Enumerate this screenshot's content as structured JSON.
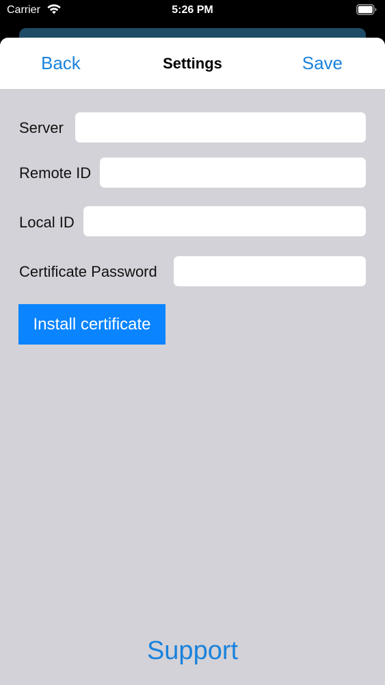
{
  "status_bar": {
    "carrier": "Carrier",
    "time": "5:26 PM",
    "icons": [
      "wifi-icon",
      "battery-icon"
    ]
  },
  "nav": {
    "back_label": "Back",
    "title": "Settings",
    "save_label": "Save"
  },
  "form": {
    "server": {
      "label": "Server",
      "value": ""
    },
    "remote_id": {
      "label": "Remote ID",
      "value": ""
    },
    "local_id": {
      "label": "Local ID",
      "value": ""
    },
    "certificate_password": {
      "label": "Certificate Password",
      "value": ""
    }
  },
  "install_button_label": "Install certificate",
  "support_label": "Support",
  "colors": {
    "accent": "#1a82dc",
    "button": "#0a84ff",
    "background": "#d3d2d8"
  }
}
